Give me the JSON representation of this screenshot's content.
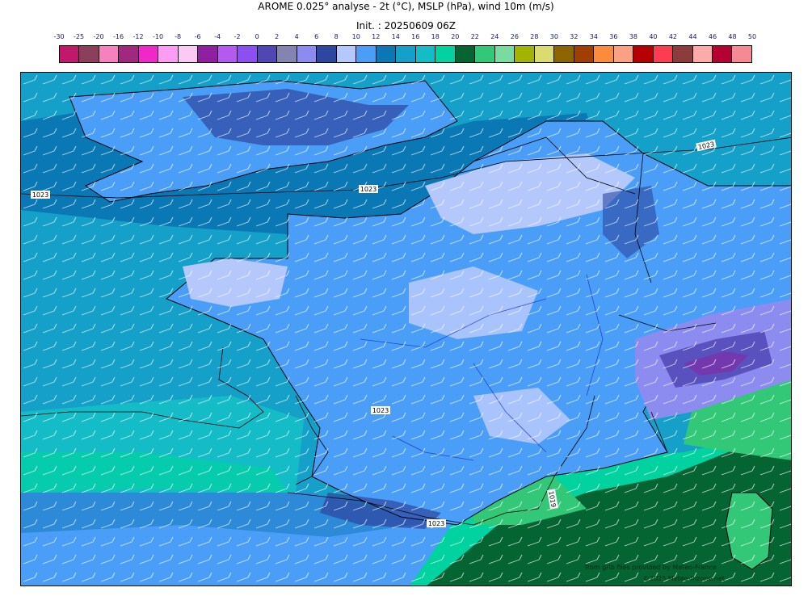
{
  "header": {
    "title": "AROME 0.025° analyse - 2t (°C), MSLP (hPa), wind 10m (m/s)",
    "init": "Init. : 20250609 06Z"
  },
  "legend": {
    "ticks": [
      "-30",
      "-25",
      "-20",
      "-16",
      "-12",
      "-10",
      "-8",
      "-6",
      "-4",
      "-2",
      "0",
      "2",
      "4",
      "6",
      "8",
      "10",
      "12",
      "14",
      "16",
      "18",
      "20",
      "22",
      "24",
      "26",
      "28",
      "30",
      "32",
      "34",
      "36",
      "38",
      "40",
      "42",
      "44",
      "46",
      "48",
      "50"
    ],
    "colors": [
      "#c2186b",
      "#8c3f5d",
      "#f781bf",
      "#a0287f",
      "#f028c8",
      "#fc9cf4",
      "#fcc8f4",
      "#9020a0",
      "#b45af0",
      "#8c50f0",
      "#5046b4",
      "#8484b0",
      "#8c8cf0",
      "#2d46a0",
      "#b4c8fc",
      "#4a9ef8",
      "#0a78b4",
      "#14a0c8",
      "#14bcc8",
      "#00d2a0",
      "#046432",
      "#32c878",
      "#78dca0",
      "#a0b400",
      "#dcdc6e",
      "#8c6400",
      "#a04000",
      "#fc8c3c",
      "#fca082",
      "#b40000",
      "#fc3c50",
      "#8c3c3c",
      "#fcaaaa",
      "#b40032",
      "#f58a94"
    ]
  },
  "map": {
    "isobar_labels": [
      "1023",
      "1023",
      "1023",
      "1023",
      "1023",
      "1019"
    ],
    "sea_colors": {
      "cool": "#14a0c8",
      "cold": "#0a78b4",
      "mild": "#14bcc8",
      "warm": "#00d2a0",
      "warmer": "#32c878",
      "hot": "#046432"
    },
    "land_colors": {
      "base": "#4a9ef8",
      "cool": "#b4c8fc",
      "cold": "#2d46a0",
      "mountain": "#8c8cf0",
      "peak": "#5046b4"
    }
  },
  "credits": {
    "line1": "from grib files provided by Meteo-France",
    "line2": "©2025 Meteo-Inzone.net"
  }
}
